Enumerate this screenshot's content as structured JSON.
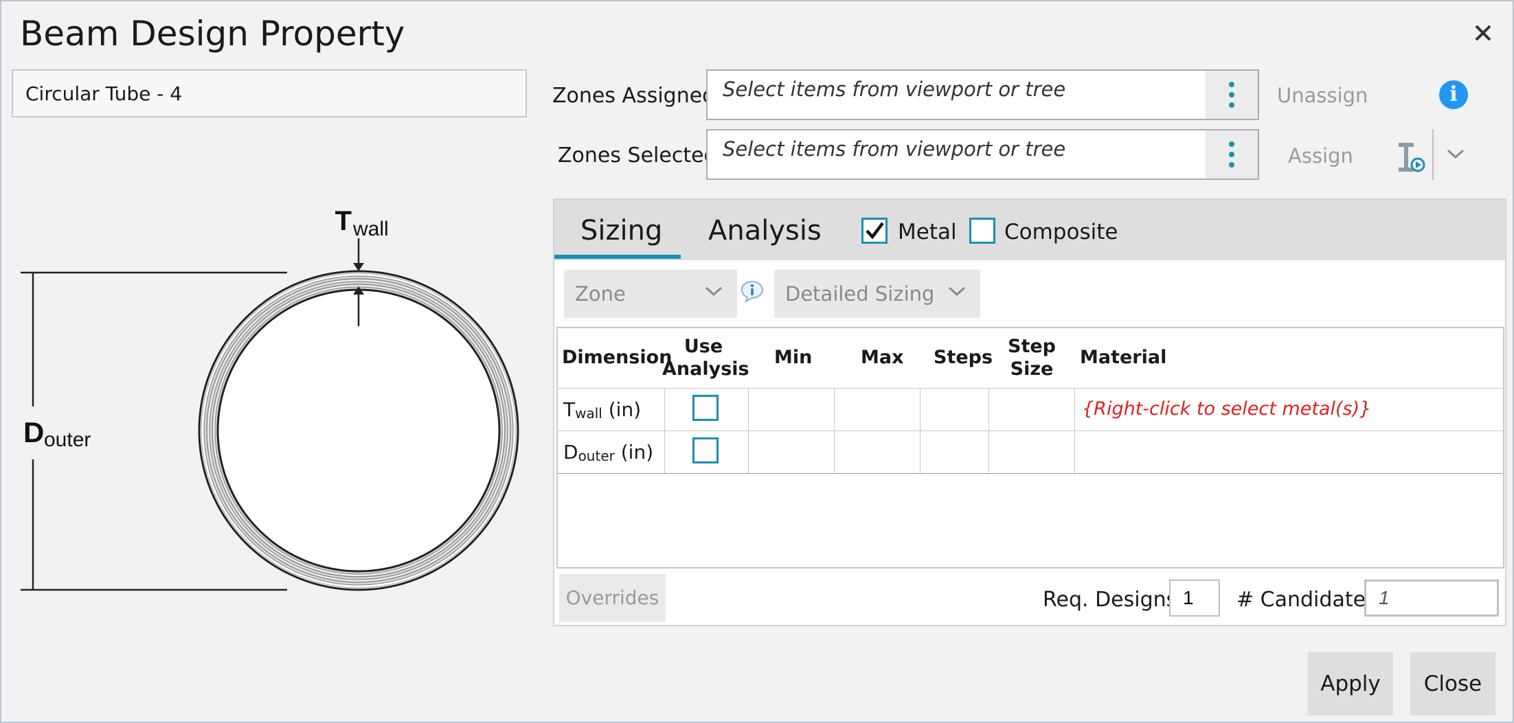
{
  "dialog": {
    "title": "Beam Design Property",
    "close_icon": "close-icon"
  },
  "property": {
    "name_value": "Circular Tube - 4"
  },
  "diagram": {
    "t_main": "T",
    "t_sub": "wall",
    "d_main": "D",
    "d_sub": "outer"
  },
  "zones": {
    "assigned_label": "Zones Assigned:",
    "assigned_placeholder": "Select items from viewport or tree",
    "selected_label": "Zones Selected:",
    "selected_placeholder": "Select items from viewport or tree",
    "unassign_label": "Unassign",
    "assign_label": "Assign",
    "info_glyph": "i"
  },
  "tabs": {
    "sizing": "Sizing",
    "analysis": "Analysis",
    "metal_label": "Metal",
    "metal_checked": true,
    "composite_label": "Composite",
    "composite_checked": false
  },
  "filters": {
    "zone_value": "Zone",
    "sizing_mode_value": "Detailed Sizing"
  },
  "table": {
    "headers": {
      "dimension": "Dimension",
      "use_analysis_1": "Use",
      "use_analysis_2": "Analysis",
      "min": "Min",
      "max": "Max",
      "steps": "Steps",
      "step_size_1": "Step",
      "step_size_2": "Size",
      "material": "Material"
    },
    "rows": [
      {
        "main": "T",
        "sub": "wall",
        "unit": " (in)",
        "use_analysis": false,
        "material": "{Right-click to select metal(s)}"
      },
      {
        "main": "D",
        "sub": "outer",
        "unit": " (in)",
        "use_analysis": false,
        "material": ""
      }
    ]
  },
  "footer": {
    "overrides_label": "Overrides",
    "req_designs_label": "Req. Designs",
    "req_designs_value": "1",
    "candidates_label": "# Candidates",
    "candidates_value": "1"
  },
  "buttons": {
    "apply": "Apply",
    "close": "Close"
  },
  "colors": {
    "accent": "#1b8fb3",
    "info": "#2196f3",
    "error_text": "#e02020"
  }
}
